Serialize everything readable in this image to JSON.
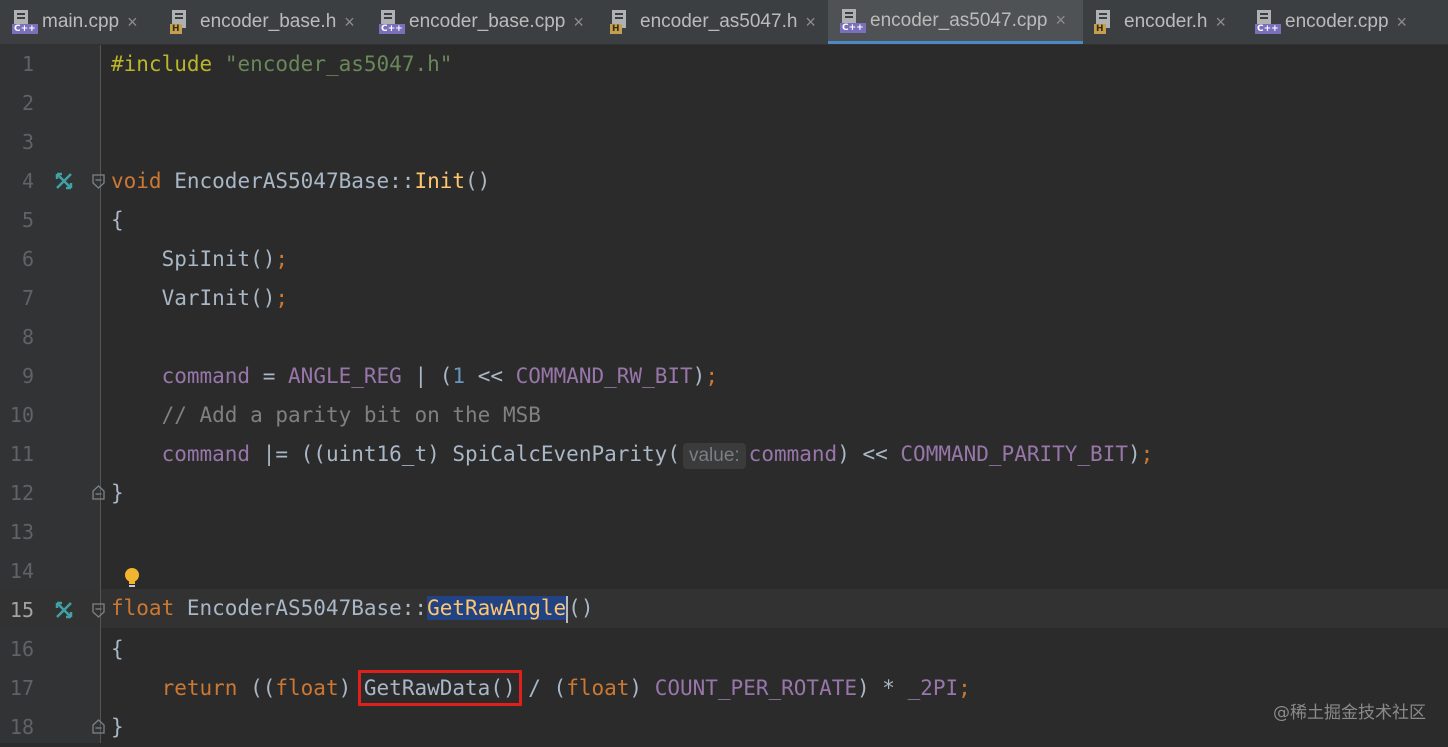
{
  "tabs": [
    {
      "label": "main.cpp",
      "type": "C++"
    },
    {
      "label": "encoder_base.h",
      "type": "H"
    },
    {
      "label": "encoder_base.cpp",
      "type": "C++"
    },
    {
      "label": "encoder_as5047.h",
      "type": "H"
    },
    {
      "label": "encoder_as5047.cpp",
      "type": "C++",
      "active": true
    },
    {
      "label": "encoder.h",
      "type": "H"
    },
    {
      "label": "encoder.cpp",
      "type": "C++"
    }
  ],
  "tab_close_glyph": "×",
  "line_numbers": [
    "1",
    "2",
    "3",
    "4",
    "5",
    "6",
    "7",
    "8",
    "9",
    "10",
    "11",
    "12",
    "13",
    "14",
    "15",
    "16",
    "17",
    "18"
  ],
  "current_line": "15",
  "code": {
    "l1": {
      "directive": "#include",
      "path": "\"encoder_as5047.h\""
    },
    "l4": {
      "kw": "void",
      "cls": "EncoderAS5047Base::",
      "fn": "Init",
      "rest": "()"
    },
    "l5": "{",
    "l6": {
      "call": "SpiInit()",
      "semi": ";"
    },
    "l7": {
      "call": "VarInit()",
      "semi": ";"
    },
    "l9": {
      "var": "command",
      "op1": " = ",
      "mac1": "ANGLE_REG",
      "op2": " | (",
      "num": "1",
      "op3": " << ",
      "mac2": "COMMAND_RW_BIT",
      "close": ")",
      "semi": ";"
    },
    "l10": "// Add a parity bit on the MSB",
    "l11": {
      "var": "command",
      "op1": " |= ((uint16_t) SpiCalcEvenParity(",
      "hint": "value:",
      "var2": "command",
      "op2": ") << ",
      "mac": "COMMAND_PARITY_BIT",
      "close": ")",
      "semi": ";"
    },
    "l12": "}",
    "l15": {
      "kw": "float",
      "cls": " EncoderAS5047Base::",
      "fn": "GetRawAngle",
      "rest": "()"
    },
    "l16": "{",
    "l17": {
      "kw": "return",
      "p1": " ((",
      "kw2": "float",
      "p2": ") ",
      "call": "GetRawData()",
      "p3": " / (",
      "kw3": "float",
      "p4": ") ",
      "mac1": "COUNT_PER_ROTATE",
      "p5": ") * ",
      "mac2": "_2PI",
      "semi": ";"
    },
    "l18": "}"
  },
  "icons": [
    "cpp-file-icon",
    "header-file-icon",
    "close-icon",
    "implemented-icon",
    "fold-icon",
    "lightbulb-icon"
  ],
  "colors": {
    "keyword": "#cc7832",
    "string": "#6a8759",
    "function": "#ffc66d",
    "macro": "#9876aa",
    "number": "#6897bb",
    "comment": "#808080",
    "highlight_box": "#e0201a",
    "selection": "#214283"
  },
  "watermark": "@稀土掘金技术社区"
}
